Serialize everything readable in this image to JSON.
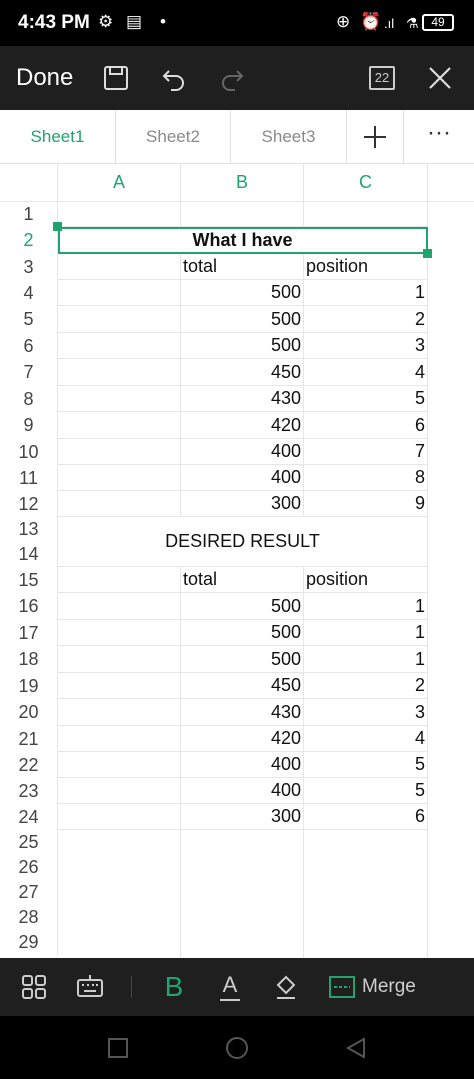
{
  "status": {
    "time": "4:43 PM",
    "battery": "49"
  },
  "toolbar": {
    "done_label": "Done",
    "zoom_label": "22"
  },
  "tabs": [
    {
      "label": "Sheet1",
      "active": true
    },
    {
      "label": "Sheet2",
      "active": false
    },
    {
      "label": "Sheet3",
      "active": false
    }
  ],
  "columns": [
    "A",
    "B",
    "C"
  ],
  "rows": [
    "1",
    "2",
    "3",
    "4",
    "5",
    "6",
    "7",
    "8",
    "9",
    "10",
    "11",
    "12",
    "13",
    "14",
    "15",
    "16",
    "17",
    "18",
    "19",
    "20",
    "21",
    "22",
    "23",
    "24",
    "25",
    "26",
    "27",
    "28",
    "29"
  ],
  "sheet": {
    "title1": "What I have",
    "title2": "DESIRED RESULT",
    "header_total": "total",
    "header_position": "position",
    "have": [
      {
        "total": "500",
        "position": "1"
      },
      {
        "total": "500",
        "position": "2"
      },
      {
        "total": "500",
        "position": "3"
      },
      {
        "total": "450",
        "position": "4"
      },
      {
        "total": "430",
        "position": "5"
      },
      {
        "total": "420",
        "position": "6"
      },
      {
        "total": "400",
        "position": "7"
      },
      {
        "total": "400",
        "position": "8"
      },
      {
        "total": "300",
        "position": "9"
      }
    ],
    "desired": [
      {
        "total": "500",
        "position": "1"
      },
      {
        "total": "500",
        "position": "1"
      },
      {
        "total": "500",
        "position": "1"
      },
      {
        "total": "450",
        "position": "2"
      },
      {
        "total": "430",
        "position": "3"
      },
      {
        "total": "420",
        "position": "4"
      },
      {
        "total": "400",
        "position": "5"
      },
      {
        "total": "400",
        "position": "5"
      },
      {
        "total": "300",
        "position": "6"
      }
    ]
  },
  "format": {
    "bold_label": "B",
    "font_color_label": "A",
    "merge_label": "Merge"
  },
  "colors": {
    "accent": "#20a36f",
    "toolbar": "#1f1f1f"
  }
}
